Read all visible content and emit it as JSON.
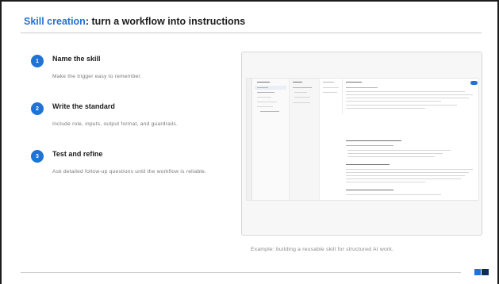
{
  "slide": {
    "title_accent": "Skill creation",
    "title_rest": ": turn a workflow into instructions"
  },
  "steps": [
    {
      "number": "1",
      "title": "Name the skill",
      "description": "Make the trigger easy to remember."
    },
    {
      "number": "2",
      "title": "Write the standard",
      "description": "Include role, inputs, output format, and guardrails."
    },
    {
      "number": "3",
      "title": "Test and refine",
      "description": "Ask detailed follow-up questions until the workflow is reliable."
    }
  ],
  "figure": {
    "caption": "Example: building a reusable skill for structured AI work."
  },
  "colors": {
    "accent": "#1e73d6",
    "logo_dark": "#0f2d59"
  },
  "icons": {
    "logo": "brand-logo-icon"
  }
}
